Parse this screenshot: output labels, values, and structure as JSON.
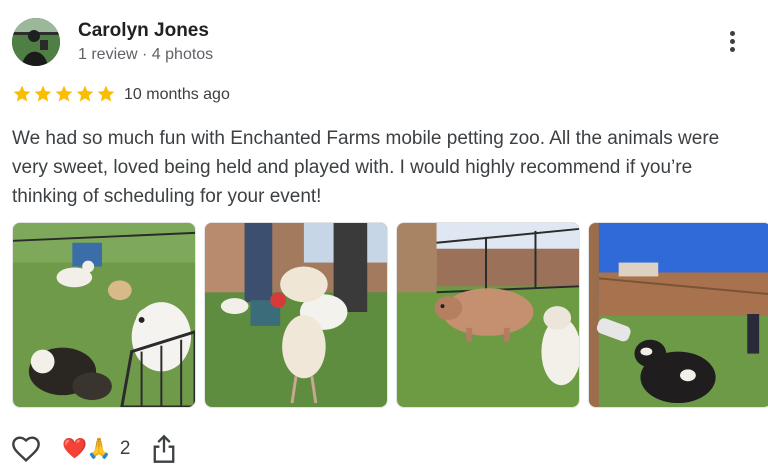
{
  "reviewer": {
    "name": "Carolyn Jones",
    "meta": "1 review · 4 photos",
    "avatar_icon": "profile-photo"
  },
  "rating": {
    "stars": 5,
    "max": 5,
    "star_color": "#fbbc04"
  },
  "date": "10 months ago",
  "review_text": "We had so much fun with Enchanted Farms mobile petting zoo. All the animals were very sweet, loved being held and played with. I would highly recommend if you’re thinking of scheduling for your event!",
  "photos": [
    {
      "description_icon": "goats-chickens-photo"
    },
    {
      "description_icon": "silkie-chicken-photo"
    },
    {
      "description_icon": "pig-photo"
    },
    {
      "description_icon": "goat-bottle-feeding-photo"
    }
  ],
  "actions": {
    "like_icon": "heart-outline-icon",
    "reactions": "❤️🙏",
    "reaction_count": "2",
    "share_icon": "share-icon",
    "more_icon": "more-vert-icon"
  }
}
